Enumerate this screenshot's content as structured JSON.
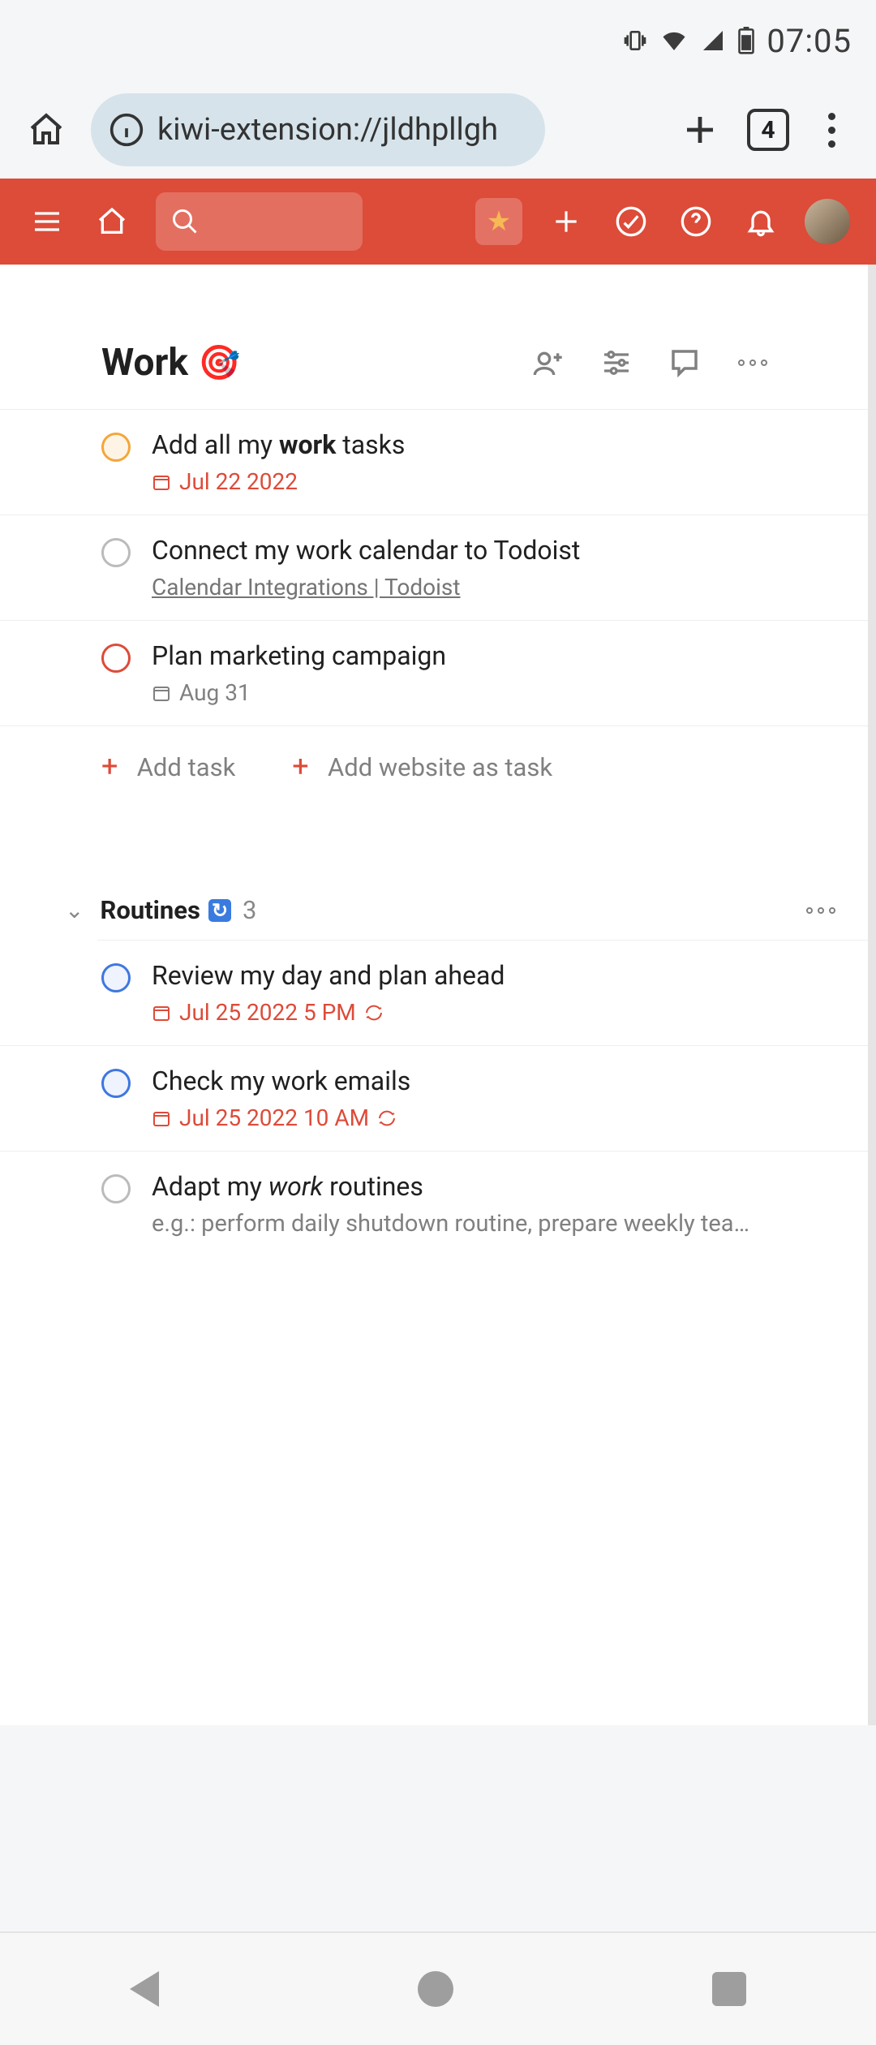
{
  "status": {
    "time": "07:05"
  },
  "browser": {
    "url": "kiwi-extension://jldhpllgh",
    "tab_count": "4"
  },
  "project": {
    "title": "Work",
    "emoji": "🎯"
  },
  "add": {
    "task": "Add task",
    "web": "Add website as task"
  },
  "tasks": [
    {
      "title_pre": "Add all my ",
      "title_bold": "work",
      "title_post": " tasks",
      "date": "Jul 22 2022"
    },
    {
      "title": "Connect my work calendar to Todoist",
      "link": "Calendar Integrations | Todoist"
    },
    {
      "title": "Plan marketing campaign",
      "date": "Aug 31"
    }
  ],
  "section": {
    "name": "Routines",
    "count": "3"
  },
  "routine_tasks": [
    {
      "title": "Review my day and plan ahead",
      "date": "Jul 25 2022 5 PM"
    },
    {
      "title": "Check my work emails",
      "date": "Jul 25 2022 10 AM"
    },
    {
      "title_pre": "Adapt my ",
      "title_italic": "work",
      "title_post": " routines",
      "note": "e.g.: perform daily shutdown routine, prepare weekly tea…"
    }
  ]
}
